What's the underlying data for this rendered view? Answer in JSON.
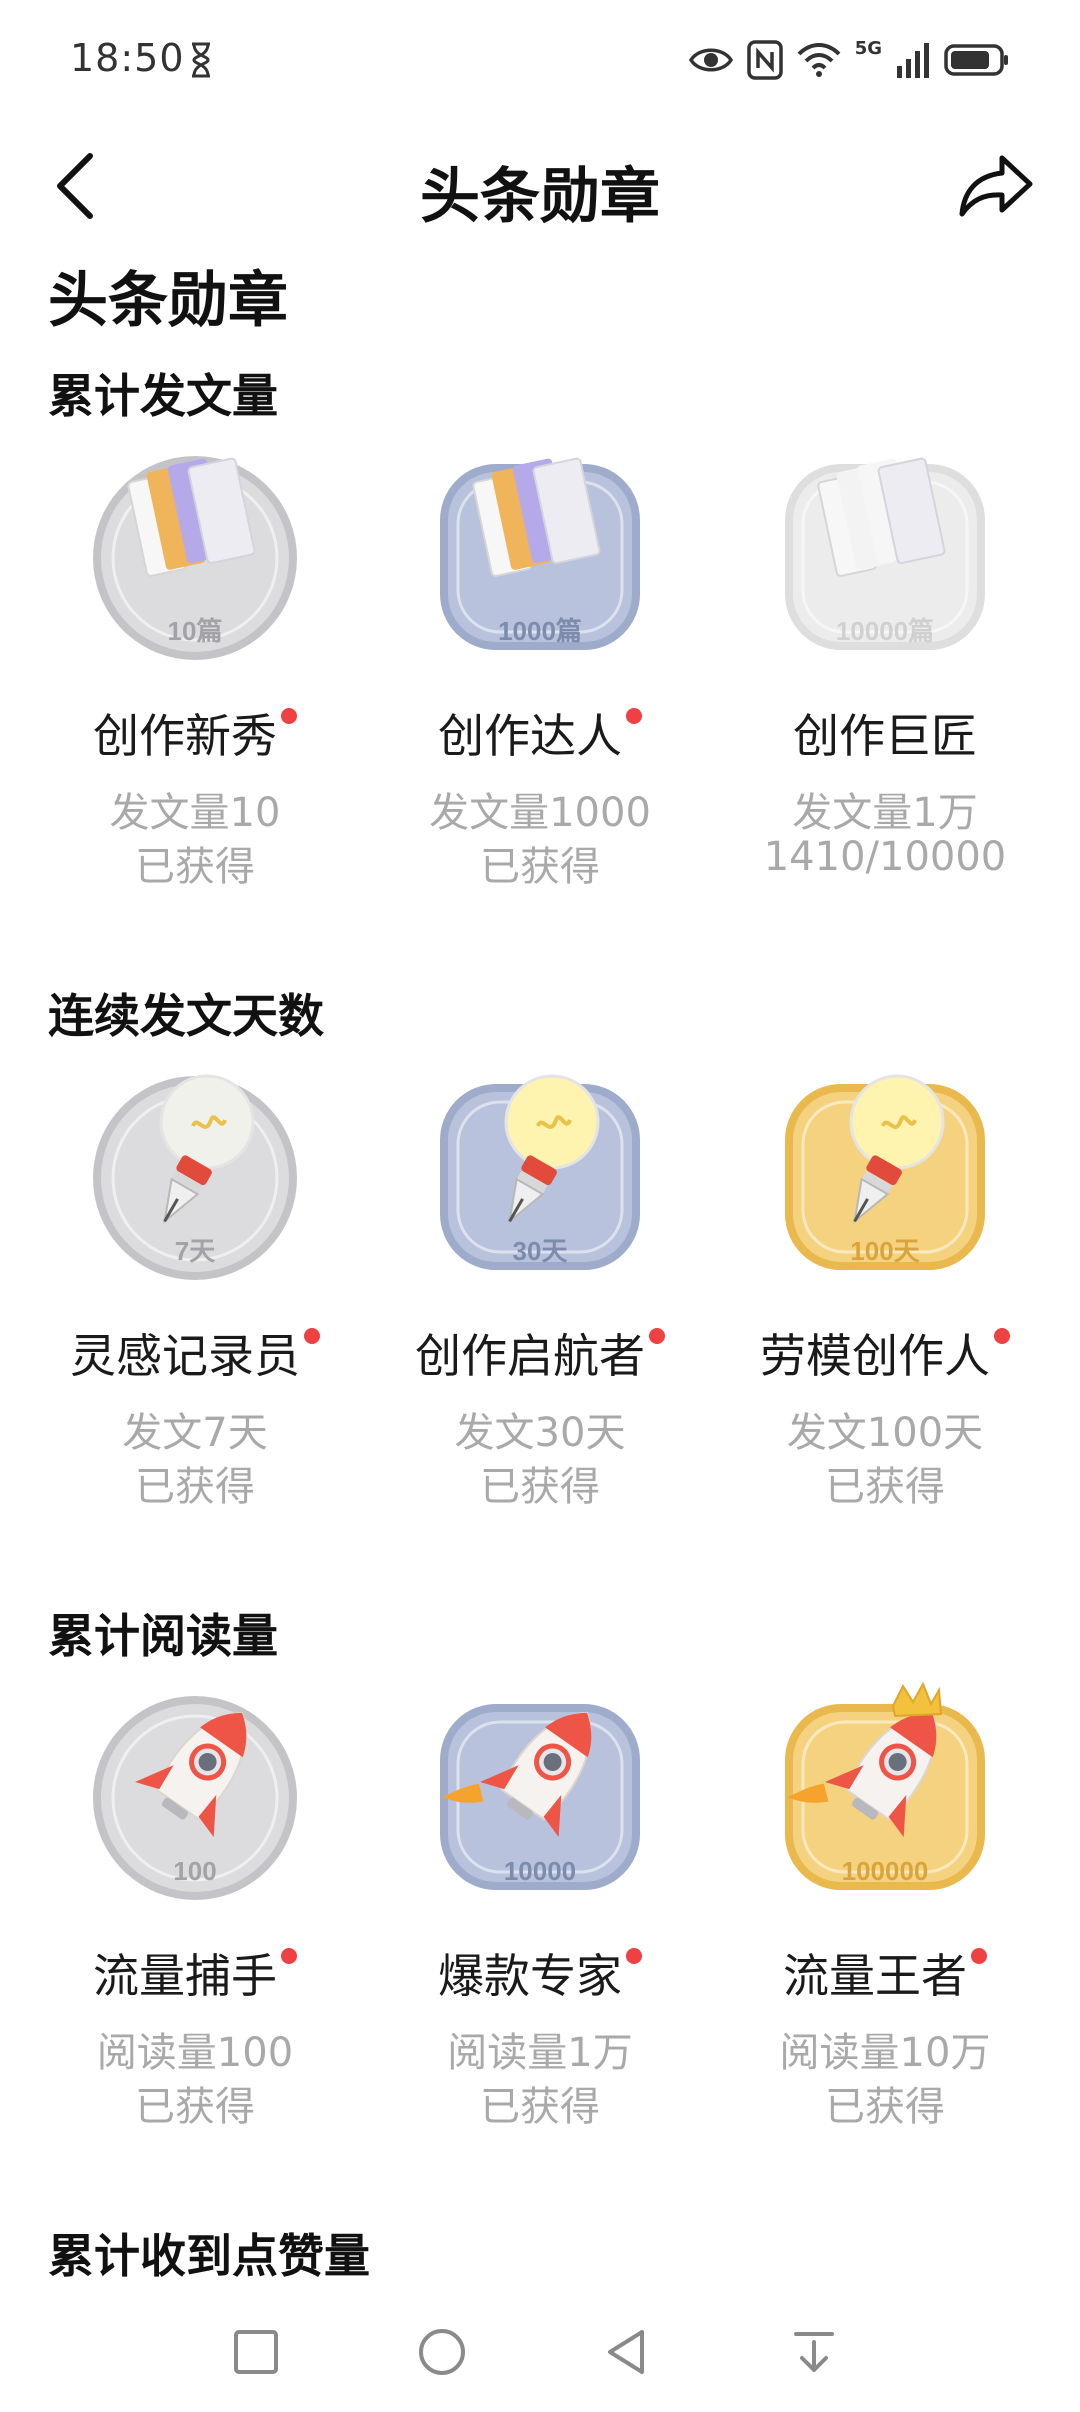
{
  "status_bar": {
    "time": "18:50",
    "net_label": "5G",
    "icons": [
      "hourglass-icon",
      "eye-icon",
      "nfc-icon",
      "wifi-icon",
      "cellular-signal-icon",
      "battery-icon"
    ]
  },
  "nav": {
    "title": "头条勋章",
    "back_icon": "chevron-left-icon",
    "share_icon": "share-icon"
  },
  "page_heading": "头条勋章",
  "sections": [
    {
      "title": "累计发文量",
      "badges": [
        {
          "name": "创作新秀",
          "requirement": "发文量10",
          "status": "已获得",
          "graphic_label": "10篇",
          "theme": "silver",
          "icon": "book-badge-icon",
          "new": true
        },
        {
          "name": "创作达人",
          "requirement": "发文量1000",
          "status": "已获得",
          "graphic_label": "1000篇",
          "theme": "blue",
          "icon": "book-badge-icon",
          "new": true
        },
        {
          "name": "创作巨匠",
          "requirement": "发文量1万",
          "status": "1410/10000",
          "graphic_label": "10000篇",
          "theme": "locked",
          "icon": "book-badge-icon",
          "new": false
        }
      ]
    },
    {
      "title": "连续发文天数",
      "badges": [
        {
          "name": "灵感记录员",
          "requirement": "发文7天",
          "status": "已获得",
          "graphic_label": "7天",
          "theme": "silver",
          "icon": "lightbulb-pen-badge-icon",
          "new": true
        },
        {
          "name": "创作启航者",
          "requirement": "发文30天",
          "status": "已获得",
          "graphic_label": "30天",
          "theme": "blue",
          "icon": "lightbulb-pen-badge-icon",
          "new": true
        },
        {
          "name": "劳模创作人",
          "requirement": "发文100天",
          "status": "已获得",
          "graphic_label": "100天",
          "theme": "gold",
          "icon": "lightbulb-pen-badge-icon",
          "new": true
        }
      ]
    },
    {
      "title": "累计阅读量",
      "badges": [
        {
          "name": "流量捕手",
          "requirement": "阅读量100",
          "status": "已获得",
          "graphic_label": "100",
          "theme": "silver",
          "icon": "rocket-badge-icon",
          "new": true
        },
        {
          "name": "爆款专家",
          "requirement": "阅读量1万",
          "status": "已获得",
          "graphic_label": "10000",
          "theme": "blue",
          "icon": "rocket-badge-icon",
          "new": true
        },
        {
          "name": "流量王者",
          "requirement": "阅读量10万",
          "status": "已获得",
          "graphic_label": "100000",
          "theme": "gold",
          "icon": "rocket-crown-badge-icon",
          "new": true
        }
      ]
    },
    {
      "title": "累计收到点赞量",
      "badges": []
    }
  ],
  "bottom_nav": {
    "icons": [
      "recent-apps-icon",
      "home-icon",
      "back-icon",
      "notification-pulldown-icon"
    ]
  },
  "colors": {
    "new_dot": "#f04142",
    "secondary_text": "#a9a9a9",
    "silver": "#d9d9db",
    "blue": "#b5bfd9",
    "gold": "#f2cf7c"
  }
}
